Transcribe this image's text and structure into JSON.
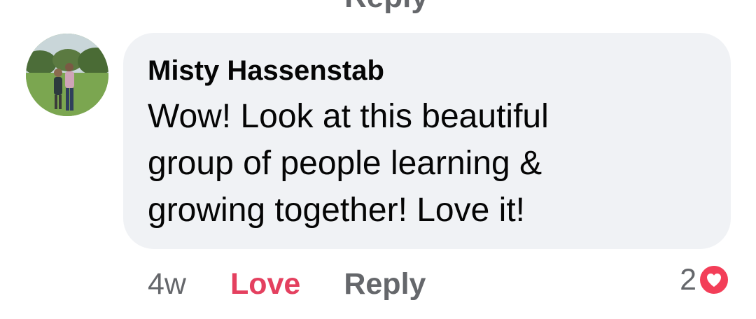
{
  "previous_comment": {
    "reply_label": "Reply"
  },
  "comment": {
    "author": "Misty Hassenstab",
    "text": "Wow! Look at this beautiful group of people learning & growing together! Love it!",
    "timestamp": "4w",
    "reaction_label": "Love",
    "reply_label": "Reply",
    "reaction_count": "2",
    "reaction_icon": "heart-icon",
    "avatar_icon": "profile-photo"
  },
  "colors": {
    "bubble_background": "#f0f2f5",
    "love_accent": "#e4405f",
    "secondary_text": "#65676b",
    "heart_badge": "#f33e58"
  }
}
